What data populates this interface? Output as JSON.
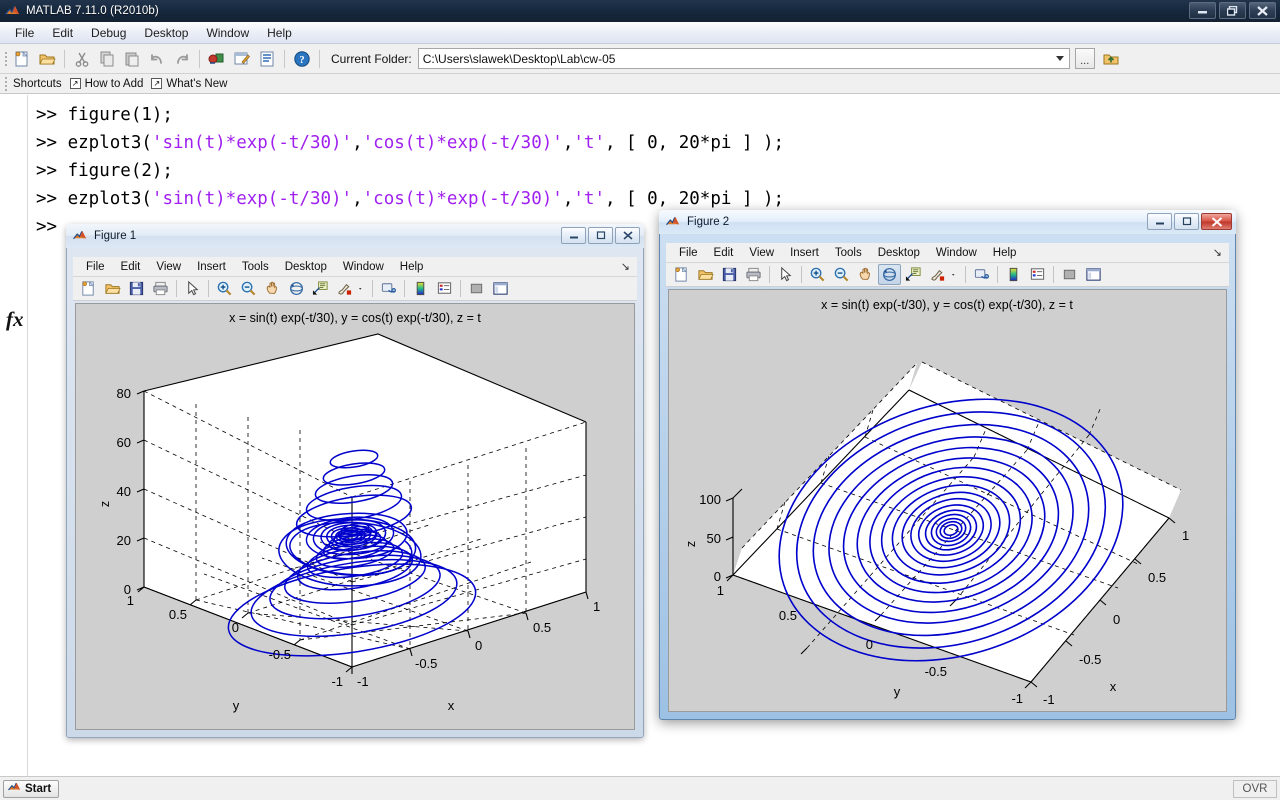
{
  "app": {
    "title": "MATLAB  7.11.0 (R2010b)",
    "logo_icon": "matlab-logo-icon",
    "window_buttons": [
      {
        "name": "minimize",
        "glyph": "–"
      },
      {
        "name": "restore",
        "glyph": "❐"
      },
      {
        "name": "close",
        "glyph": "✕"
      }
    ]
  },
  "menubar": {
    "items": [
      "File",
      "Edit",
      "Debug",
      "Desktop",
      "Window",
      "Help"
    ]
  },
  "toolbar": {
    "buttons": [
      {
        "name": "new-script-icon",
        "tip": "New"
      },
      {
        "name": "open-folder-icon",
        "tip": "Open"
      },
      {
        "name": "cut-icon",
        "tip": "Cut"
      },
      {
        "name": "copy-icon",
        "tip": "Copy"
      },
      {
        "name": "paste-icon",
        "tip": "Paste"
      },
      {
        "name": "undo-icon",
        "tip": "Undo"
      },
      {
        "name": "redo-icon",
        "tip": "Redo"
      },
      {
        "name": "simulink-icon",
        "tip": "Simulink Library"
      },
      {
        "name": "guide-icon",
        "tip": "GUIDE"
      },
      {
        "name": "profiler-icon",
        "tip": "Profiler"
      },
      {
        "name": "help-icon",
        "tip": "Help"
      }
    ],
    "current_folder_label": "Current Folder:",
    "current_folder_value": "C:\\Users\\slawek\\Desktop\\Lab\\cw-05",
    "browse_label": "...",
    "up_folder_icon": "up-folder-icon"
  },
  "shortcuts_bar": {
    "label": "Shortcuts",
    "items": [
      "How to Add",
      "What's New"
    ]
  },
  "command_window": {
    "prompt": ">>",
    "lines": [
      {
        "prompt": ">> ",
        "parts": [
          {
            "t": "figure(1);",
            "c": "plain"
          }
        ]
      },
      {
        "prompt": ">> ",
        "parts": [
          {
            "t": "ezplot3(",
            "c": "plain"
          },
          {
            "t": "'sin(t)*exp(-t/30)'",
            "c": "string"
          },
          {
            "t": ",",
            "c": "plain"
          },
          {
            "t": "'cos(t)*exp(-t/30)'",
            "c": "string"
          },
          {
            "t": ",",
            "c": "plain"
          },
          {
            "t": "'t'",
            "c": "string"
          },
          {
            "t": ", [ 0, 20*pi ] );",
            "c": "plain"
          }
        ]
      },
      {
        "prompt": ">> ",
        "parts": [
          {
            "t": "figure(2);",
            "c": "plain"
          }
        ]
      },
      {
        "prompt": ">> ",
        "parts": [
          {
            "t": "ezplot3(",
            "c": "plain"
          },
          {
            "t": "'sin(t)*exp(-t/30)'",
            "c": "string"
          },
          {
            "t": ",",
            "c": "plain"
          },
          {
            "t": "'cos(t)*exp(-t/30)'",
            "c": "string"
          },
          {
            "t": ",",
            "c": "plain"
          },
          {
            "t": "'t'",
            "c": "string"
          },
          {
            "t": ", [ 0, 20*pi ] );",
            "c": "plain"
          }
        ]
      },
      {
        "prompt": ">>",
        "parts": []
      }
    ],
    "fx_symbol": "fx"
  },
  "status_bar": {
    "start_label": "Start",
    "overwrite_label": "OVR"
  },
  "figure1": {
    "title": "Figure 1",
    "active": false,
    "menu": [
      "File",
      "Edit",
      "View",
      "Insert",
      "Tools",
      "Desktop",
      "Window",
      "Help"
    ],
    "window_buttons": [
      {
        "name": "minimize",
        "glyph": "–"
      },
      {
        "name": "restore",
        "glyph": "❐"
      },
      {
        "name": "close",
        "glyph": "✕"
      }
    ],
    "toolbar_icons": [
      "new-figure-icon",
      "open-file-icon",
      "save-figure-icon",
      "print-figure-icon",
      "edit-plot-pointer-icon",
      "zoom-in-icon",
      "zoom-out-icon",
      "pan-icon",
      "rotate-3d-icon",
      "data-cursor-icon",
      "brush-icon",
      "brush-dropdown-icon",
      "link-plot-icon",
      "colorbar-icon",
      "legend-icon",
      "hide-plot-tools-icon",
      "show-plot-tools-icon"
    ],
    "pressed_tool": null,
    "plot": {
      "title": "x = sin(t) exp(-t/30), y = cos(t) exp(-t/30), z = t",
      "zlabel": "z",
      "xlabel": "x",
      "ylabel": "y",
      "zticks": [
        "0",
        "20",
        "40",
        "60",
        "80"
      ],
      "xticks": [
        "-1",
        "-0.5",
        "0",
        "0.5",
        "1"
      ],
      "yticks": [
        "-1",
        "-0.5",
        "0",
        "0.5",
        "1"
      ]
    }
  },
  "figure2": {
    "title": "Figure 2",
    "active": true,
    "menu": [
      "File",
      "Edit",
      "View",
      "Insert",
      "Tools",
      "Desktop",
      "Window",
      "Help"
    ],
    "window_buttons": [
      {
        "name": "minimize",
        "glyph": "–"
      },
      {
        "name": "restore",
        "glyph": "❐"
      },
      {
        "name": "close",
        "glyph": "✕"
      }
    ],
    "toolbar_icons": [
      "new-figure-icon",
      "open-file-icon",
      "save-figure-icon",
      "print-figure-icon",
      "edit-plot-pointer-icon",
      "zoom-in-icon",
      "zoom-out-icon",
      "pan-icon",
      "rotate-3d-icon",
      "data-cursor-icon",
      "brush-icon",
      "brush-dropdown-icon",
      "link-plot-icon",
      "colorbar-icon",
      "legend-icon",
      "hide-plot-tools-icon",
      "show-plot-tools-icon"
    ],
    "pressed_tool": "rotate-3d-icon",
    "plot": {
      "title": "x = sin(t) exp(-t/30), y = cos(t) exp(-t/30), z = t",
      "zlabel": "z",
      "xlabel": "x",
      "ylabel": "y",
      "zticks": [
        "0",
        "50",
        "100"
      ],
      "xticks": [
        "-1",
        "-0.5",
        "0",
        "0.5",
        "1"
      ],
      "yticks": [
        "-1",
        "-0.5",
        "0",
        "0.5",
        "1"
      ]
    }
  },
  "chart_data": {
    "type": "line",
    "title": "x = sin(t) exp(-t/30), y = cos(t) exp(-t/30), z = t",
    "xlabel": "x",
    "ylabel": "y",
    "zlabel": "z",
    "parametric": {
      "x_expr": "sin(t)*exp(-t/30)",
      "y_expr": "cos(t)*exp(-t/30)",
      "z_expr": "t",
      "t_range": [
        0,
        62.83
      ]
    },
    "series_color": "#0000cc",
    "figure1_axes": {
      "xlim": [
        -1,
        1
      ],
      "ylim": [
        -1,
        1
      ],
      "zlim": [
        0,
        80
      ],
      "xticks": [
        -1,
        -0.5,
        0,
        0.5,
        1
      ],
      "yticks": [
        -1,
        -0.5,
        0,
        0.5,
        1
      ],
      "zticks": [
        0,
        20,
        40,
        60,
        80
      ],
      "grid": true,
      "view": "default 3-D (az -37.5, el 30)"
    },
    "figure2_axes": {
      "xlim": [
        -1,
        1
      ],
      "ylim": [
        -1,
        1
      ],
      "zlim": [
        0,
        100
      ],
      "xticks": [
        -1,
        -0.5,
        0,
        0.5,
        1
      ],
      "yticks": [
        -1,
        -0.5,
        0,
        0.5,
        1
      ],
      "zticks": [
        0,
        50,
        100
      ],
      "grid": true,
      "view": "rotated near top-down (high elevation)"
    }
  }
}
